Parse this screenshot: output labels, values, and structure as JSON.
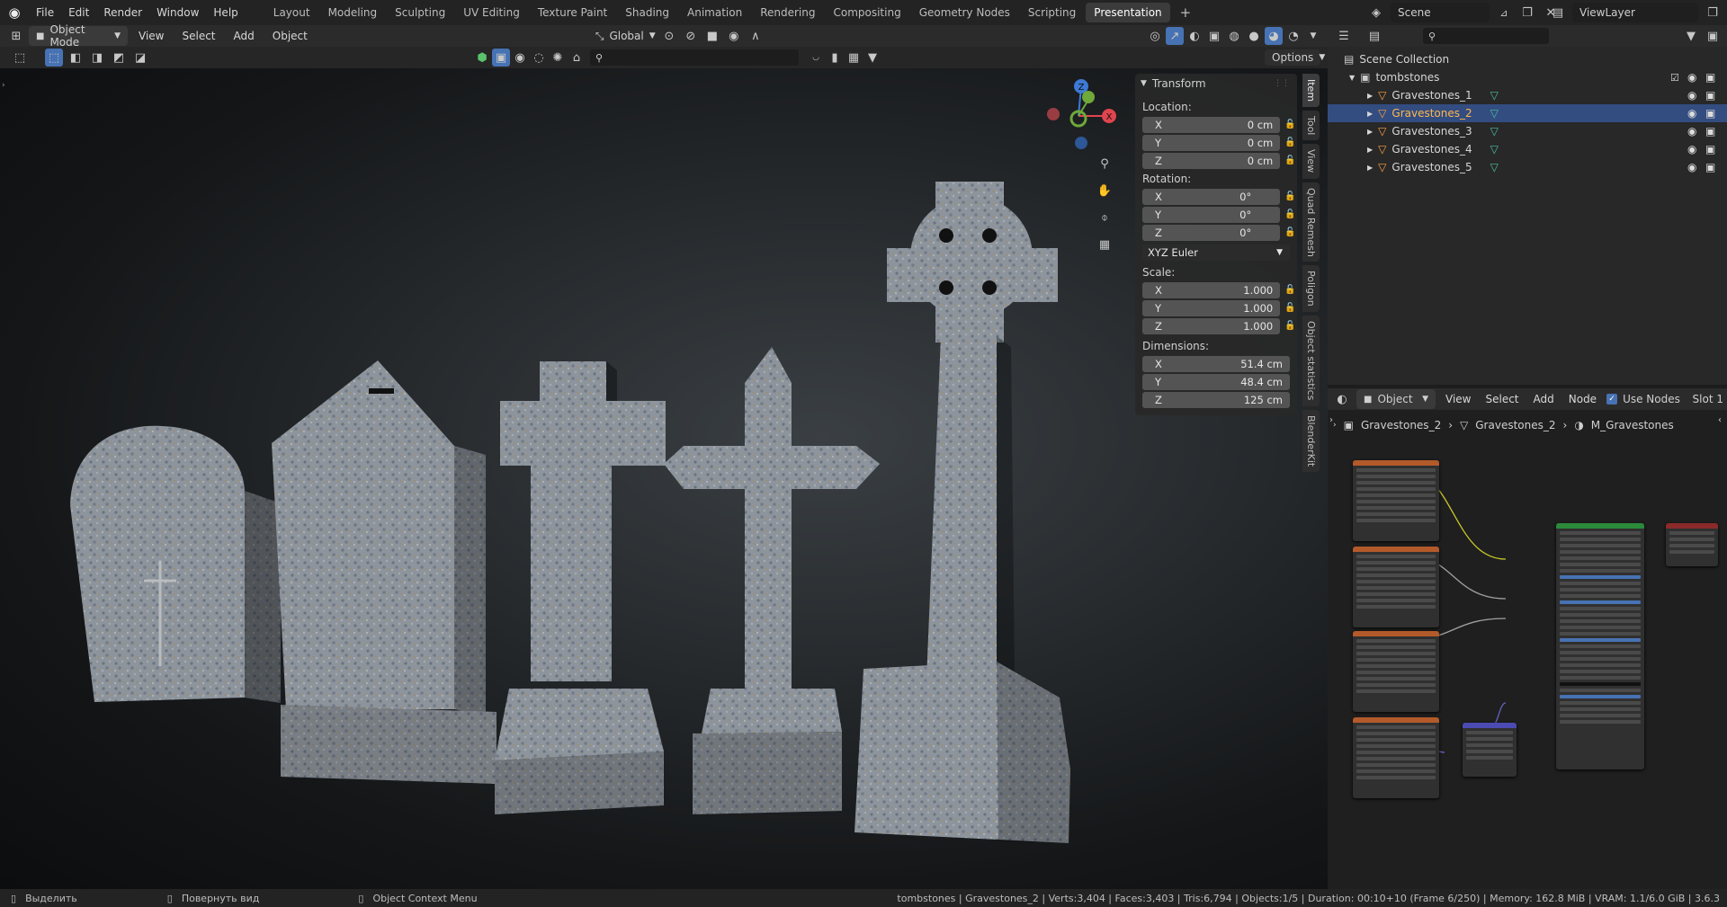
{
  "topbar": {
    "menus": [
      "File",
      "Edit",
      "Render",
      "Window",
      "Help"
    ],
    "workspaces": [
      "Layout",
      "Modeling",
      "Sculpting",
      "UV Editing",
      "Texture Paint",
      "Shading",
      "Animation",
      "Rendering",
      "Compositing",
      "Geometry Nodes",
      "Scripting",
      "Presentation"
    ],
    "active_workspace": "Presentation",
    "add_tab": "+",
    "scene": "Scene",
    "view_layer": "ViewLayer"
  },
  "viewport_header": {
    "mode": "Object Mode",
    "menus": [
      "View",
      "Select",
      "Add",
      "Object"
    ],
    "orientation": "Global",
    "options": "Options"
  },
  "npanel": {
    "section": "Transform",
    "location_label": "Location:",
    "location": {
      "x": "0 cm",
      "y": "0 cm",
      "z": "0 cm"
    },
    "rotation_label": "Rotation:",
    "rotation": {
      "x": "0°",
      "y": "0°",
      "z": "0°"
    },
    "rotation_mode": "XYZ Euler",
    "scale_label": "Scale:",
    "scale": {
      "x": "1.000",
      "y": "1.000",
      "z": "1.000"
    },
    "dimensions_label": "Dimensions:",
    "dimensions": {
      "x": "51.4 cm",
      "y": "48.4 cm",
      "z": "125 cm"
    },
    "axis": {
      "x": "X",
      "y": "Y",
      "z": "Z"
    }
  },
  "sidetabs": [
    "Item",
    "Tool",
    "View",
    "Quad Remesh",
    "Poligon",
    "Object statistics",
    "BlenderKit"
  ],
  "outliner": {
    "root": "Scene Collection",
    "collection": "tombstones",
    "objects": [
      "Gravestones_1",
      "Gravestones_2",
      "Gravestones_3",
      "Gravestones_4",
      "Gravestones_5"
    ],
    "selected": "Gravestones_2"
  },
  "node_editor": {
    "type": "Object",
    "menus": [
      "View",
      "Select",
      "Add",
      "Node"
    ],
    "use_nodes": "Use Nodes",
    "slot": "Slot 1",
    "breadcrumb": [
      "Gravestones_2",
      "Gravestones_2",
      "M_Gravestones"
    ]
  },
  "statusbar": {
    "left1": "Выделить",
    "left2": "Повернуть вид",
    "left3": "Object Context Menu",
    "right": "tombstones | Gravestones_2 | Verts:3,404 | Faces:3,403 | Tris:6,794 | Objects:1/5 | Duration: 00:10+10 (Frame 6/250) | Memory: 162.8 MiB | VRAM: 1.1/6.0 GiB | 3.6.3"
  },
  "colors": {
    "accent": "#4772b3",
    "selected_row": "#334d80",
    "selected_name": "#ffb74d",
    "gizmo_x": "#e0454e",
    "gizmo_y": "#6fa83b",
    "gizmo_z": "#3d7ad6"
  }
}
